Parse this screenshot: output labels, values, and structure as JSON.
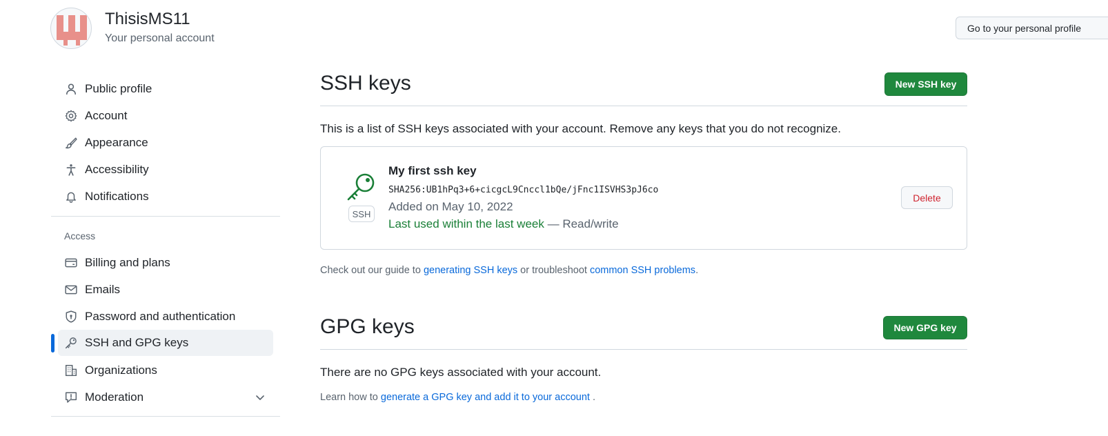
{
  "header": {
    "account_name": "ThisisMS11",
    "account_subtitle": "Your personal account",
    "goto_button": "Go to your personal profile"
  },
  "sidebar": {
    "items_top": [
      {
        "label": "Public profile",
        "icon": "person-icon"
      },
      {
        "label": "Account",
        "icon": "gear-icon"
      },
      {
        "label": "Appearance",
        "icon": "paintbrush-icon"
      },
      {
        "label": "Accessibility",
        "icon": "accessibility-icon"
      },
      {
        "label": "Notifications",
        "icon": "bell-icon"
      }
    ],
    "access_heading": "Access",
    "items_access": [
      {
        "label": "Billing and plans",
        "icon": "credit-card-icon"
      },
      {
        "label": "Emails",
        "icon": "mail-icon"
      },
      {
        "label": "Password and authentication",
        "icon": "shield-lock-icon"
      },
      {
        "label": "SSH and GPG keys",
        "icon": "key-icon",
        "active": true
      },
      {
        "label": "Organizations",
        "icon": "organization-icon"
      },
      {
        "label": "Moderation",
        "icon": "report-icon",
        "expandable": true
      }
    ]
  },
  "ssh": {
    "title": "SSH keys",
    "new_button": "New SSH key",
    "description": "This is a list of SSH keys associated with your account. Remove any keys that you do not recognize.",
    "key": {
      "name": "My first ssh key",
      "fingerprint": "SHA256:UB1hPq3+6+cicgcL9Cnccl1bQe/jFnc1ISVHS3pJ6co",
      "added": "Added on May 10, 2022",
      "last_used": "Last used within the last week",
      "access": "— Read/write",
      "badge": "SSH",
      "delete_button": "Delete"
    },
    "guide_prefix": "Check out our guide to ",
    "guide_link1": "generating SSH keys",
    "guide_middle": " or troubleshoot ",
    "guide_link2": "common SSH problems",
    "guide_suffix": "."
  },
  "gpg": {
    "title": "GPG keys",
    "new_button": "New GPG key",
    "description": "There are no GPG keys associated with your account.",
    "learn_prefix": "Learn how to ",
    "learn_link": "generate a GPG key and add it to your account",
    "learn_suffix": " ."
  },
  "colors": {
    "accent": "#0969da",
    "primary_button": "#1f883d",
    "danger": "#cf222e",
    "success_text": "#1a7f37",
    "avatar": "#e8908a"
  }
}
